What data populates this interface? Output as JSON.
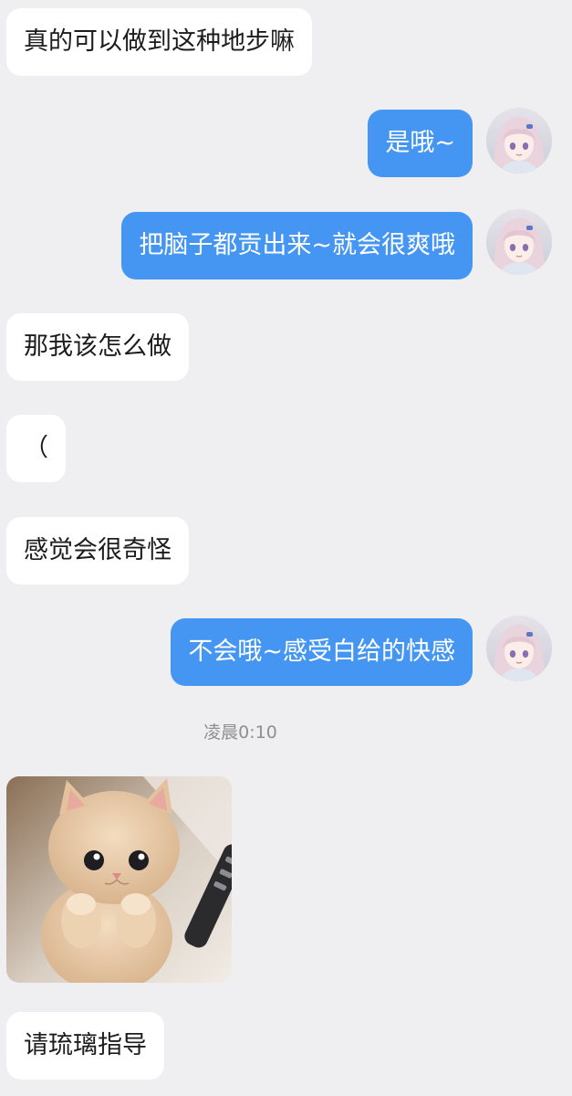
{
  "messages": [
    {
      "text": "真的可以做到这种地步嘛",
      "side": "incoming"
    },
    {
      "text": "是哦~",
      "side": "outgoing"
    },
    {
      "text": "把脑子都贡出来~就会很爽哦",
      "side": "outgoing"
    },
    {
      "text": "那我该怎么做",
      "side": "incoming"
    },
    {
      "text": "（",
      "side": "incoming"
    },
    {
      "text": "感觉会很奇怪",
      "side": "incoming"
    },
    {
      "text": "不会哦~感受白给的快感",
      "side": "outgoing"
    },
    {
      "text": "请琉璃指导",
      "side": "incoming"
    }
  ],
  "timestamp": "凌晨0:10",
  "sticker": {
    "icon": "kitten-sticker-image"
  },
  "avatar": {
    "icon": "anime-girl-avatar"
  },
  "colors": {
    "background": "#efeff2",
    "incoming_bubble": "#ffffff",
    "outgoing_bubble": "#4596f3",
    "outgoing_text": "#ffffff",
    "timestamp_text": "#8e8e93"
  }
}
